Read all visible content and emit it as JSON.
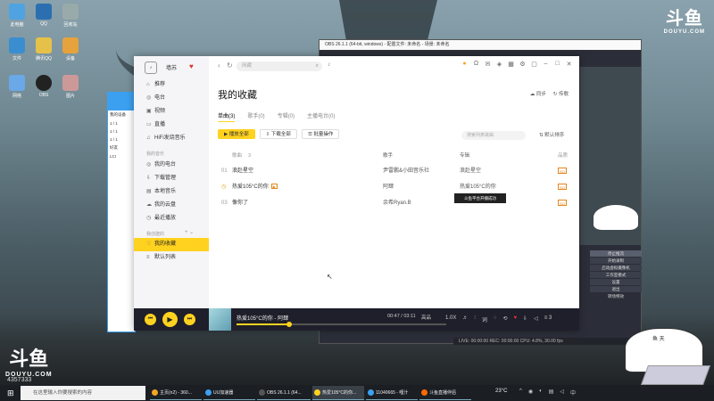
{
  "player": {
    "user": "墙苏",
    "nav_main": [
      {
        "label": "推荐",
        "icon": "home-icon"
      },
      {
        "label": "电台",
        "icon": "radio-icon"
      },
      {
        "label": "视频",
        "icon": "video-icon"
      },
      {
        "label": "直播",
        "icon": "live-icon"
      },
      {
        "label": "HiFi发烧音乐",
        "icon": "hifi-icon"
      }
    ],
    "section_mine": "我的音乐",
    "nav_mine": [
      {
        "label": "我的电台",
        "icon": "radio-icon"
      },
      {
        "label": "下载管理",
        "icon": "download-icon"
      },
      {
        "label": "本地音乐",
        "icon": "folder-icon"
      },
      {
        "label": "我的云盘",
        "icon": "cloud-icon"
      },
      {
        "label": "最近播放",
        "icon": "clock-icon"
      }
    ],
    "section_created": "我创建的",
    "nav_created": [
      {
        "label": "我的收藏",
        "icon": "heart-icon",
        "active": true
      },
      {
        "label": "默认列表",
        "icon": "list-icon"
      }
    ],
    "search_placeholder": "网藏",
    "page_title": "我的收藏",
    "sync": "同步",
    "share": "传歌",
    "tabs": [
      "单曲(3)",
      "歌手(0)",
      "专辑(0)",
      "主播电台(0)"
    ],
    "actions": {
      "play_all": "播放全部",
      "download_all": "下载全部",
      "batch": "批量操作"
    },
    "list_search": "搜索列表歌曲",
    "sort": "默认排序",
    "table_headers": {
      "title": "歌曲",
      "count": "3",
      "artist": "歌手",
      "album": "专辑",
      "quality": "品质"
    },
    "songs": [
      {
        "idx": "01",
        "title": "浪赴星空",
        "artist": "尹雷鹏&小田音乐社",
        "album": "浪赴星空",
        "hq": "SQ"
      },
      {
        "idx": "",
        "title": "热爱105°C的你",
        "mv": "▶",
        "artist": "阿肆",
        "album": "热爱105°C的你",
        "hq": "SQ"
      },
      {
        "idx": "03",
        "title": "像你了",
        "artist": "余希Ryan.B",
        "album": "",
        "hq": "SQ"
      }
    ],
    "tooltip": "斗鱼平台开播成功",
    "now_playing": "热爱105°C的你 - 阿肆",
    "time": "00:47 / 03:11",
    "quality_btn": "高品",
    "speed": "1.0X",
    "count_badge": "3",
    "progress": 0.25,
    "accent": "#ffd21f"
  },
  "obs": {
    "title": "OBS 26.1.1 (64-bit, windows) - 配置文件: 未命名 - 场景: 未命名",
    "menu": [
      "停止推流",
      "开始录制",
      "启动虚拟摄像机",
      "工作室模式",
      "设置",
      "退出",
      "转场特效"
    ],
    "status": "LIVE: 00:00:00  REC: 00:00:00  CPU: 4.8%, 30.00 fps"
  },
  "qq": {
    "items": [
      "我的设备",
      "1 / 1",
      "1 / 1",
      "1 / 1",
      "好友",
      "LCI"
    ]
  },
  "desktop": {
    "icons": [
      "此电脑",
      "QQ",
      "回收站",
      "文件",
      "腾讯QQ",
      "设备",
      "网络",
      "OBS",
      "图片"
    ],
    "douyu": "斗鱼",
    "douyu_en": "DOUYU.COM",
    "viewers": "4357333"
  },
  "bongo": {
    "label": "鱼 天"
  },
  "taskbar": {
    "search": "在这里输入你要搜索的内容",
    "tasks": [
      {
        "label": "主页(n2) - 360...",
        "color": "#f5a623"
      },
      {
        "label": "UU加速器",
        "color": "#3ca0f0"
      },
      {
        "label": "OBS 26.1.1 (64...",
        "color": "#555555"
      },
      {
        "label": "热爱105°C的你...",
        "color": "#ffd21f",
        "active": true
      },
      {
        "label": "11040665 - 哩汁",
        "color": "#3ca0f0"
      },
      {
        "label": "斗鱼直播伴侣",
        "color": "#ff6a00"
      }
    ],
    "temp": "23°C"
  }
}
